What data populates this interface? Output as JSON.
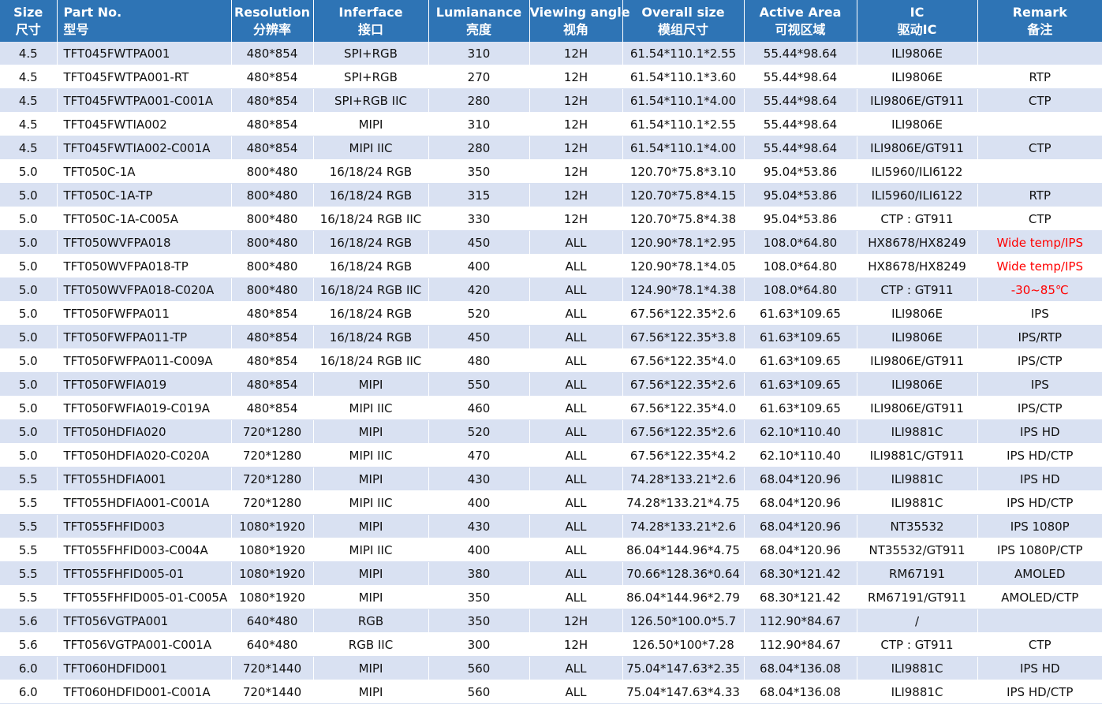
{
  "header": {
    "size": [
      "Size",
      "尺寸"
    ],
    "part": [
      "Part No.",
      "型号"
    ],
    "resolution": [
      "Resolution",
      "分辨率"
    ],
    "interface": [
      "Inferface",
      "接口"
    ],
    "luminance": [
      "Lumianance",
      "亮度"
    ],
    "viewing": [
      "Viewing angle",
      "视角"
    ],
    "overall": [
      "Overall size",
      "模组尺寸"
    ],
    "active": [
      "Active Area",
      "可视区域"
    ],
    "ic": [
      "IC",
      "驱动IC"
    ],
    "remark": [
      "Remark",
      "备注"
    ]
  },
  "colors": {
    "header_bg": "#2e74b5",
    "stripe": "#d9e1f2",
    "remark_red": "#ff0000"
  },
  "rows": [
    {
      "size": "4.5",
      "part": "TFT045FWTPA001",
      "res": "480*854",
      "if": "SPI+RGB",
      "lum": "310",
      "view": "12H",
      "overall": "61.54*110.1*2.55",
      "active": "55.44*98.64",
      "ic": "ILI9806E",
      "remark": "",
      "red": false
    },
    {
      "size": "4.5",
      "part": "TFT045FWTPA001-RT",
      "res": "480*854",
      "if": "SPI+RGB",
      "lum": "270",
      "view": "12H",
      "overall": "61.54*110.1*3.60",
      "active": "55.44*98.64",
      "ic": "ILI9806E",
      "remark": "RTP",
      "red": false
    },
    {
      "size": "4.5",
      "part": "TFT045FWTPA001-C001A",
      "res": "480*854",
      "if": "SPI+RGB IIC",
      "lum": "280",
      "view": "12H",
      "overall": "61.54*110.1*4.00",
      "active": "55.44*98.64",
      "ic": "ILI9806E/GT911",
      "remark": "CTP",
      "red": false
    },
    {
      "size": "4.5",
      "part": "TFT045FWTIA002",
      "res": "480*854",
      "if": "MIPI",
      "lum": "310",
      "view": "12H",
      "overall": "61.54*110.1*2.55",
      "active": "55.44*98.64",
      "ic": "ILI9806E",
      "remark": "",
      "red": false
    },
    {
      "size": "4.5",
      "part": "TFT045FWTIA002-C001A",
      "res": "480*854",
      "if": "MIPI IIC",
      "lum": "280",
      "view": "12H",
      "overall": "61.54*110.1*4.00",
      "active": "55.44*98.64",
      "ic": "ILI9806E/GT911",
      "remark": "CTP",
      "red": false
    },
    {
      "size": "5.0",
      "part": "TFT050C-1A",
      "res": "800*480",
      "if": "16/18/24 RGB",
      "lum": "350",
      "view": "12H",
      "overall": "120.70*75.8*3.10",
      "active": "95.04*53.86",
      "ic": "ILI5960/ILI6122",
      "remark": "",
      "red": false
    },
    {
      "size": "5.0",
      "part": "TFT050C-1A-TP",
      "res": "800*480",
      "if": "16/18/24 RGB",
      "lum": "315",
      "view": "12H",
      "overall": "120.70*75.8*4.15",
      "active": "95.04*53.86",
      "ic": "ILI5960/ILI6122",
      "remark": "RTP",
      "red": false
    },
    {
      "size": "5.0",
      "part": "TFT050C-1A-C005A",
      "res": "800*480",
      "if": "16/18/24 RGB IIC",
      "lum": "330",
      "view": "12H",
      "overall": "120.70*75.8*4.38",
      "active": "95.04*53.86",
      "ic": "CTP : GT911",
      "remark": "CTP",
      "red": false
    },
    {
      "size": "5.0",
      "part": "TFT050WVFPA018",
      "res": "800*480",
      "if": "16/18/24 RGB",
      "lum": "450",
      "view": "ALL",
      "overall": "120.90*78.1*2.95",
      "active": "108.0*64.80",
      "ic": "HX8678/HX8249",
      "remark": "Wide temp/IPS",
      "red": true
    },
    {
      "size": "5.0",
      "part": "TFT050WVFPA018-TP",
      "res": "800*480",
      "if": "16/18/24 RGB",
      "lum": "400",
      "view": "ALL",
      "overall": "120.90*78.1*4.05",
      "active": "108.0*64.80",
      "ic": "HX8678/HX8249",
      "remark": "Wide temp/IPS",
      "red": true
    },
    {
      "size": "5.0",
      "part": "TFT050WVFPA018-C020A",
      "res": "800*480",
      "if": "16/18/24 RGB IIC",
      "lum": "420",
      "view": "ALL",
      "overall": "124.90*78.1*4.38",
      "active": "108.0*64.80",
      "ic": "CTP : GT911",
      "remark": "-30~85℃",
      "red": true
    },
    {
      "size": "5.0",
      "part": "TFT050FWFPA011",
      "res": "480*854",
      "if": "16/18/24 RGB",
      "lum": "520",
      "view": "ALL",
      "overall": "67.56*122.35*2.6",
      "active": "61.63*109.65",
      "ic": "ILI9806E",
      "remark": "IPS",
      "red": false
    },
    {
      "size": "5.0",
      "part": "TFT050FWFPA011-TP",
      "res": "480*854",
      "if": "16/18/24 RGB",
      "lum": "450",
      "view": "ALL",
      "overall": "67.56*122.35*3.8",
      "active": "61.63*109.65",
      "ic": "ILI9806E",
      "remark": "IPS/RTP",
      "red": false
    },
    {
      "size": "5.0",
      "part": "TFT050FWFPA011-C009A",
      "res": "480*854",
      "if": "16/18/24 RGB IIC",
      "lum": "480",
      "view": "ALL",
      "overall": "67.56*122.35*4.0",
      "active": "61.63*109.65",
      "ic": "ILI9806E/GT911",
      "remark": "IPS/CTP",
      "red": false
    },
    {
      "size": "5.0",
      "part": "TFT050FWFIA019",
      "res": "480*854",
      "if": "MIPI",
      "lum": "550",
      "view": "ALL",
      "overall": "67.56*122.35*2.6",
      "active": "61.63*109.65",
      "ic": "ILI9806E",
      "remark": "IPS",
      "red": false
    },
    {
      "size": "5.0",
      "part": "TFT050FWFIA019-C019A",
      "res": "480*854",
      "if": "MIPI IIC",
      "lum": "460",
      "view": "ALL",
      "overall": "67.56*122.35*4.0",
      "active": "61.63*109.65",
      "ic": "ILI9806E/GT911",
      "remark": "IPS/CTP",
      "red": false
    },
    {
      "size": "5.0",
      "part": "TFT050HDFIA020",
      "res": "720*1280",
      "if": "MIPI",
      "lum": "520",
      "view": "ALL",
      "overall": "67.56*122.35*2.6",
      "active": "62.10*110.40",
      "ic": "ILI9881C",
      "remark": "IPS HD",
      "red": false
    },
    {
      "size": "5.0",
      "part": "TFT050HDFIA020-C020A",
      "res": "720*1280",
      "if": "MIPI IIC",
      "lum": "470",
      "view": "ALL",
      "overall": "67.56*122.35*4.2",
      "active": "62.10*110.40",
      "ic": "ILI9881C/GT911",
      "remark": "IPS HD/CTP",
      "red": false
    },
    {
      "size": "5.5",
      "part": "TFT055HDFIA001",
      "res": "720*1280",
      "if": "MIPI",
      "lum": "430",
      "view": "ALL",
      "overall": "74.28*133.21*2.6",
      "active": "68.04*120.96",
      "ic": "ILI9881C",
      "remark": "IPS HD",
      "red": false
    },
    {
      "size": "5.5",
      "part": "TFT055HDFIA001-C001A",
      "res": "720*1280",
      "if": "MIPI IIC",
      "lum": "400",
      "view": "ALL",
      "overall": "74.28*133.21*4.75",
      "active": "68.04*120.96",
      "ic": "ILI9881C",
      "remark": "IPS HD/CTP",
      "red": false
    },
    {
      "size": "5.5",
      "part": "TFT055FHFID003",
      "res": "1080*1920",
      "if": "MIPI",
      "lum": "430",
      "view": "ALL",
      "overall": "74.28*133.21*2.6",
      "active": "68.04*120.96",
      "ic": "NT35532",
      "remark": "IPS 1080P",
      "red": false
    },
    {
      "size": "5.5",
      "part": "TFT055FHFID003-C004A",
      "res": "1080*1920",
      "if": "MIPI IIC",
      "lum": "400",
      "view": "ALL",
      "overall": "86.04*144.96*4.75",
      "active": "68.04*120.96",
      "ic": "NT35532/GT911",
      "remark": "IPS 1080P/CTP",
      "red": false
    },
    {
      "size": "5.5",
      "part": "TFT055FHFID005-01",
      "res": "1080*1920",
      "if": "MIPI",
      "lum": "380",
      "view": "ALL",
      "overall": "70.66*128.36*0.64",
      "active": "68.30*121.42",
      "ic": "RM67191",
      "remark": "AMOLED",
      "red": false
    },
    {
      "size": "5.5",
      "part": "TFT055FHFID005-01-C005A",
      "res": "1080*1920",
      "if": "MIPI",
      "lum": "350",
      "view": "ALL",
      "overall": "86.04*144.96*2.79",
      "active": "68.30*121.42",
      "ic": "RM67191/GT911",
      "remark": "AMOLED/CTP",
      "red": false
    },
    {
      "size": "5.6",
      "part": "TFT056VGTPA001",
      "res": "640*480",
      "if": "RGB",
      "lum": "350",
      "view": "12H",
      "overall": "126.50*100.0*5.7",
      "active": "112.90*84.67",
      "ic": "/",
      "remark": "",
      "red": false
    },
    {
      "size": "5.6",
      "part": "TFT056VGTPA001-C001A",
      "res": "640*480",
      "if": "RGB IIC",
      "lum": "300",
      "view": "12H",
      "overall": "126.50*100*7.28",
      "active": "112.90*84.67",
      "ic": "CTP : GT911",
      "remark": "CTP",
      "red": false
    },
    {
      "size": "6.0",
      "part": "TFT060HDFID001",
      "res": "720*1440",
      "if": "MIPI",
      "lum": "560",
      "view": "ALL",
      "overall": "75.04*147.63*2.35",
      "active": "68.04*136.08",
      "ic": "ILI9881C",
      "remark": "IPS HD",
      "red": false
    },
    {
      "size": "6.0",
      "part": "TFT060HDFID001-C001A",
      "res": "720*1440",
      "if": "MIPI",
      "lum": "560",
      "view": "ALL",
      "overall": "75.04*147.63*4.33",
      "active": "68.04*136.08",
      "ic": "ILI9881C",
      "remark": "IPS HD/CTP",
      "red": false
    }
  ]
}
